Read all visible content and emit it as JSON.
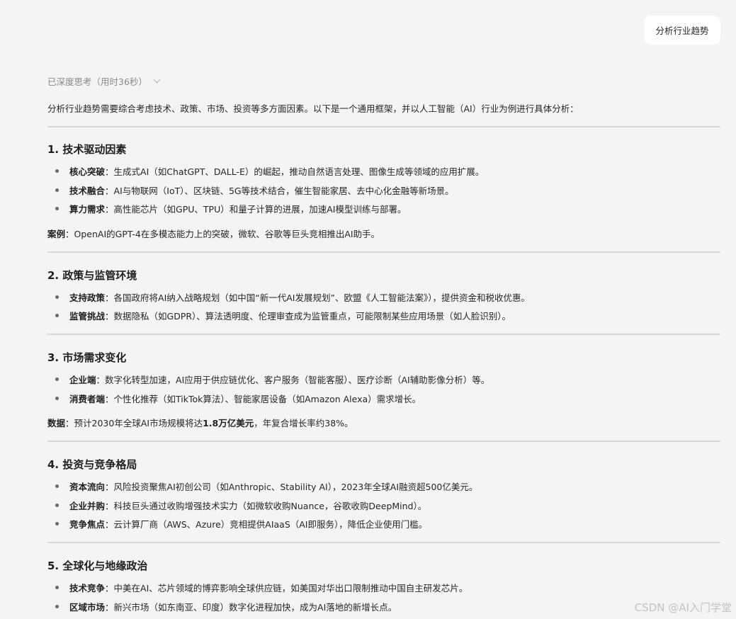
{
  "user_message": "分析行业趋势",
  "thinking_label": "已深度思考（用时36秒）",
  "intro": "分析行业趋势需要综合考虑技术、政策、市场、投资等多方面因素。以下是一个通用框架，并以人工智能（AI）行业为例进行具体分析：",
  "sections": [
    {
      "title": "1. 技术驱动因素",
      "bullets": [
        {
          "label": "核心突破",
          "text": "：生成式AI（如ChatGPT、DALL-E）的崛起，推动自然语言处理、图像生成等领域的应用扩展。"
        },
        {
          "label": "技术融合",
          "text": "：AI与物联网（IoT）、区块链、5G等技术结合，催生智能家居、去中心化金融等新场景。"
        },
        {
          "label": "算力需求",
          "text": "：高性能芯片（如GPU、TPU）和量子计算的进展，加速AI模型训练与部署。"
        }
      ],
      "note": {
        "label": "案例",
        "text": "：OpenAI的GPT-4在多模态能力上的突破，微软、谷歌等巨头竞相推出AI助手。"
      }
    },
    {
      "title": "2. 政策与监管环境",
      "bullets": [
        {
          "label": "支持政策",
          "text": "：各国政府将AI纳入战略规划（如中国“新一代AI发展规划”、欧盟《人工智能法案》），提供资金和税收优惠。"
        },
        {
          "label": "监管挑战",
          "text": "：数据隐私（如GDPR）、算法透明度、伦理审查成为监管重点，可能限制某些应用场景（如人脸识别）。"
        }
      ]
    },
    {
      "title": "3. 市场需求变化",
      "bullets": [
        {
          "label": "企业端",
          "text": "：数字化转型加速，AI应用于供应链优化、客户服务（智能客服）、医疗诊断（AI辅助影像分析）等。"
        },
        {
          "label": "消费者端",
          "text": "：个性化推荐（如TikTok算法）、智能家居设备（如Amazon Alexa）需求增长。"
        }
      ],
      "note": {
        "label": "数据",
        "text_before": "：预计2030年全球AI市场规模将达",
        "highlight": "1.8万亿美元",
        "text_after": "，年复合增长率约38%。"
      }
    },
    {
      "title": "4. 投资与竞争格局",
      "bullets": [
        {
          "label": "资本流向",
          "text": "：风险投资聚焦AI初创公司（如Anthropic、Stability AI），2023年全球AI融资超500亿美元。"
        },
        {
          "label": "企业并购",
          "text": "：科技巨头通过收购增强技术实力（如微软收购Nuance，谷歌收购DeepMind）。"
        },
        {
          "label": "竞争焦点",
          "text": "：云计算厂商（AWS、Azure）竞相提供AIaaS（AI即服务），降低企业使用门槛。"
        }
      ]
    },
    {
      "title": "5. 全球化与地缘政治",
      "bullets": [
        {
          "label": "技术竞争",
          "text": "：中美在AI、芯片领域的博弈影响全球供应链，如美国对华出口限制推动中国自主研发芯片。"
        },
        {
          "label": "区域市场",
          "text": "：新兴市场（如东南亚、印度）数字化进程加快，成为AI落地的新增长点。"
        }
      ]
    }
  ],
  "watermark": "CSDN @AI入门学堂",
  "colors": {
    "background": "#f4f4f4",
    "bubble": "#ffffff",
    "divider": "#d9d9d9",
    "muted_text": "#8a8a8a"
  }
}
